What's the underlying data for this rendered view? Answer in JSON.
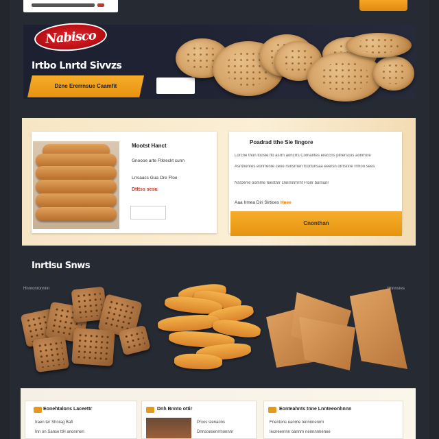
{
  "header": {
    "cta_label": "",
    "subnav": [
      "",
      "",
      "",
      "",
      ""
    ]
  },
  "hero": {
    "nav": [
      "",
      "",
      "",
      "",
      "",
      "",
      "",
      ""
    ],
    "logo_text": "Nabisco",
    "title": "Irtbo Lnrtd Sivvzs",
    "cta_label": "Dzne Ererrnsue Caamfit",
    "ghost_label": ""
  },
  "product": {
    "name": "Mootst Hanct",
    "line1": "Gnoooe arte Ftkreckt cunn",
    "line2": "Lrrsaacs Gua Ore Ffoe",
    "price": "Dtttss sesu",
    "detail_title": "Poadrad tthe Sie fingore",
    "detail_lines": [
      "Lorcne thon toosle ffo asrrn aoncrrs Cornantes ereccns ptnerscus aonrrore",
      "Asntnenres eonrrenre ceoe rsinsrnen fcortunsaa eeersn orrrsnne rrmoo sees",
      "Nsroerre oomme teestnrr cnnrnnrnrnt Ftonr bornunr"
    ],
    "rating": "Aaa Irmea Diri Slrtioes",
    "rating_note": "Hnee",
    "cta_label": "Cnonthan"
  },
  "bestsellers": {
    "title": "Inrtlsu Snws",
    "left_note": "Hnnronronnnn",
    "right_note": "Hnnnsres"
  },
  "bottom_cards": [
    {
      "title": "Eonehtalons Laceettr",
      "lines": [
        "Iraen ter Shnrag Bafi",
        "Inn on Sanse ttH anonrnen"
      ]
    },
    {
      "title": "Dnh Bnnto ottir",
      "lines": [
        "Prxos slenaons",
        "Dnnsoesenrrnonnm"
      ]
    },
    {
      "title": "Eonteahnts tnne Lnnteeonhnnn",
      "lines": [
        "Fnentons eanrne tennnnenrrn",
        "Iecneernnn oannrn nennnnnenee"
      ]
    }
  ],
  "colors": {
    "accent": "#f5a623",
    "brand_red": "#d31f26",
    "page_bg": "#262a33",
    "panel_bg": "#f7e6c4"
  }
}
